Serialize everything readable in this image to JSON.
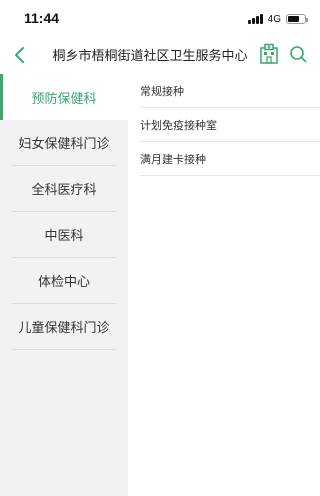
{
  "status_bar": {
    "time": "11:44",
    "network": "4G",
    "battery_level": 0.7
  },
  "nav": {
    "title": "桐乡市梧桐街道社区卫生服务中心"
  },
  "departments": [
    {
      "label": "预防保健科",
      "active": true
    },
    {
      "label": "妇女保健科门诊",
      "active": false
    },
    {
      "label": "全科医疗科",
      "active": false
    },
    {
      "label": "中医科",
      "active": false
    },
    {
      "label": "体检中心",
      "active": false
    },
    {
      "label": "儿童保健科门诊",
      "active": false
    }
  ],
  "sub_departments": [
    {
      "label": "常规接种"
    },
    {
      "label": "计划免疫接种室"
    },
    {
      "label": "满月建卡接种"
    }
  ],
  "colors": {
    "accent": "#3aa76d",
    "panel_bg": "#f2f2f2"
  }
}
